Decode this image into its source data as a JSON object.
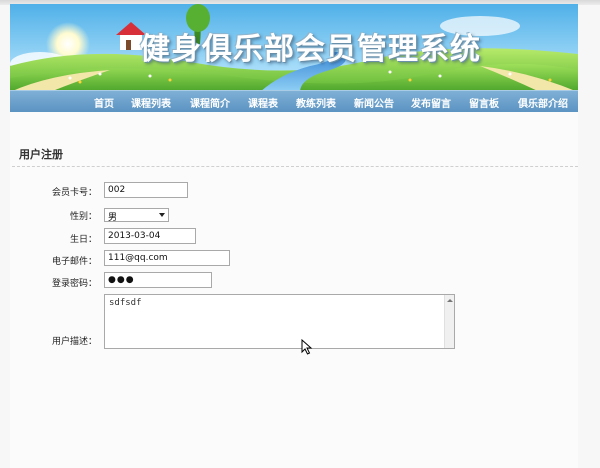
{
  "banner": {
    "title": "健身俱乐部会员管理系统"
  },
  "nav": {
    "items": [
      {
        "label": "首页"
      },
      {
        "label": "课程列表"
      },
      {
        "label": "课程简介"
      },
      {
        "label": "课程表"
      },
      {
        "label": "教练列表"
      },
      {
        "label": "新闻公告"
      },
      {
        "label": "发布留言"
      },
      {
        "label": "留言板"
      },
      {
        "label": "俱乐部介绍"
      }
    ]
  },
  "section": {
    "title": "用户注册"
  },
  "form": {
    "card_label": "会员卡号：",
    "card_value": "002",
    "gender_label": "性别：",
    "gender_value": "男",
    "birthday_label": "生日：",
    "birthday_value": "2013-03-04",
    "email_label": "电子邮件：",
    "email_value": "111@qq.com",
    "password_label": "登录密码：",
    "password_value": "●●●",
    "desc_label": "用户描述：",
    "desc_value": "sdfsdf"
  },
  "icons": {
    "select_arrow": "chevron-down-icon",
    "scroll_up": "scroll-up-icon",
    "cursor": "mouse-pointer-icon"
  },
  "colors": {
    "nav_bar": "#6aa2cf",
    "banner_sky": "#7ec8ee",
    "banner_grass": "#6cc23a"
  }
}
